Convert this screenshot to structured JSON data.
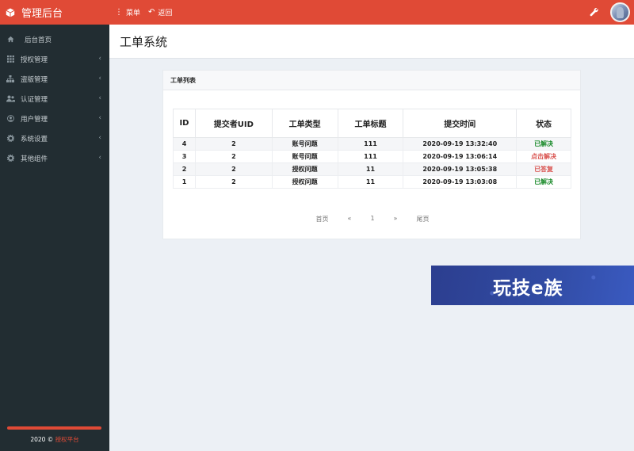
{
  "brand": {
    "title": "管理后台",
    "logo_icon": "cube-icon"
  },
  "topnav": {
    "menu_label": "菜单",
    "back_label": "返回",
    "menu_icon": "vertical-dots-icon",
    "back_icon": "undo-icon"
  },
  "header_icons": {
    "settings": "wrench-icon",
    "user": "avatar"
  },
  "sidebar": {
    "items": [
      {
        "label": "后台首页",
        "icon": "home-icon"
      },
      {
        "label": "授权管理",
        "icon": "grid-icon"
      },
      {
        "label": "盗版管理",
        "icon": "sitemap-icon"
      },
      {
        "label": "认证管理",
        "icon": "users-icon"
      },
      {
        "label": "用户管理",
        "icon": "user-circle-icon"
      },
      {
        "label": "系统设置",
        "icon": "gear-icon"
      },
      {
        "label": "其他组件",
        "icon": "gear-icon"
      }
    ],
    "footer_text": "2020 © ",
    "footer_link": "授权平台"
  },
  "page": {
    "title": "工单系统"
  },
  "panel": {
    "title": "工单列表",
    "columns": [
      "ID",
      "提交者UID",
      "工单类型",
      "工单标题",
      "提交时间",
      "状态"
    ],
    "rows": [
      {
        "id": "4",
        "uid": "2",
        "type": "账号问题",
        "title": "111",
        "time": "2020-09-19 13:32:40",
        "status": "已解决",
        "status_color": "#1a8a2a"
      },
      {
        "id": "3",
        "uid": "2",
        "type": "账号问题",
        "title": "111",
        "time": "2020-09-19 13:06:14",
        "status": "点击解决",
        "status_color": "#d9534f"
      },
      {
        "id": "2",
        "uid": "2",
        "type": "授权问题",
        "title": "11",
        "time": "2020-09-19 13:05:38",
        "status": "已答复",
        "status_color": "#d9534f"
      },
      {
        "id": "1",
        "uid": "2",
        "type": "授权问题",
        "title": "11",
        "time": "2020-09-19 13:03:08",
        "status": "已解决",
        "status_color": "#1a8a2a"
      }
    ],
    "pagination": {
      "first": "首页",
      "prev": "«",
      "current": "1",
      "next": "»",
      "last": "尾页"
    }
  },
  "banner": {
    "text": "玩技e族"
  },
  "colors": {
    "accent": "#e04a36",
    "sidebar_bg": "#222d32",
    "banner_bg": "#314ba3"
  }
}
